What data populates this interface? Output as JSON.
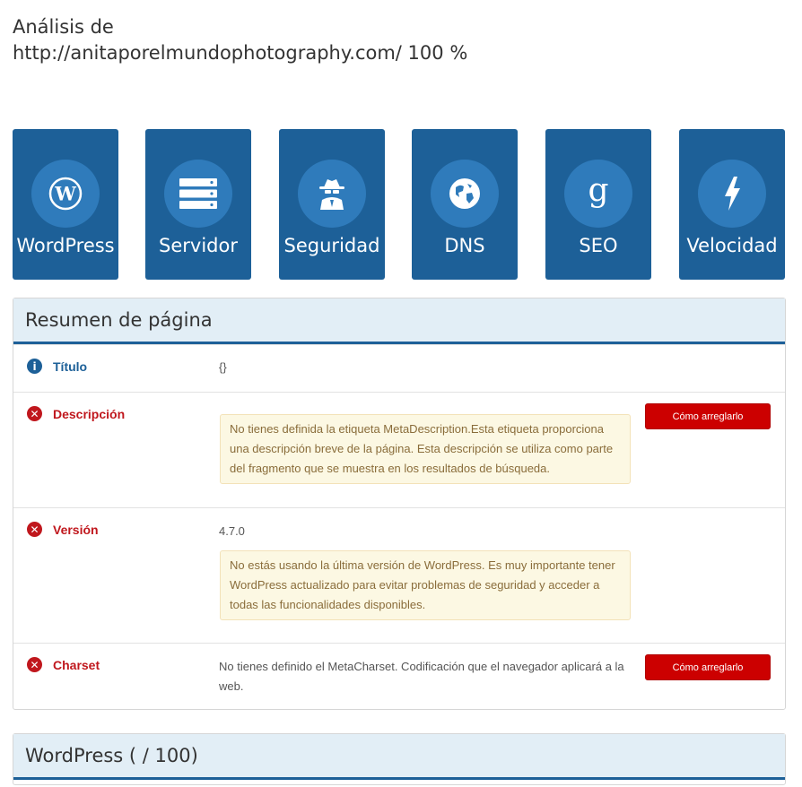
{
  "header": {
    "title_line1": "Análisis de",
    "title_line2": "http://anitaporelmundophotography.com/ 100 %"
  },
  "tiles": [
    {
      "label": "WordPress",
      "icon": "wordpress-icon"
    },
    {
      "label": "Servidor",
      "icon": "server-icon"
    },
    {
      "label": "Seguridad",
      "icon": "spy-icon"
    },
    {
      "label": "DNS",
      "icon": "globe-icon"
    },
    {
      "label": "SEO",
      "icon": "google-g-icon"
    },
    {
      "label": "Velocidad",
      "icon": "bolt-icon"
    }
  ],
  "colors": {
    "tile_bg": "#1d6098",
    "tile_circle": "#2f7bbb",
    "error": "#c0171d",
    "button": "#cc0000",
    "panel_heading_bg": "#e2eef6"
  },
  "summary": {
    "heading": "Resumen de página",
    "rows": [
      {
        "status": "info",
        "name": "Título",
        "value": "{}"
      },
      {
        "status": "error",
        "name": "Descripción",
        "alert": "No tienes definida la etiqueta MetaDescription.Esta etiqueta proporciona una descripción breve de la página. Esta descripción se utiliza como parte del fragmento que se muestra en los resultados de búsqueda.",
        "button": "Cómo arreglarlo"
      },
      {
        "status": "error",
        "name": "Versión",
        "value": "4.7.0",
        "alert": "No estás usando la última versión de WordPress. Es muy importante tener WordPress actualizado para evitar problemas de seguridad y acceder a todas las funcionalidades disponibles."
      },
      {
        "status": "error",
        "name": "Charset",
        "value": "No tienes definido el MetaCharset. Codificación que el navegador aplicará a la web.",
        "button": "Cómo arreglarlo"
      }
    ]
  },
  "wordpress_panel": {
    "heading": "WordPress ( / 100)"
  }
}
